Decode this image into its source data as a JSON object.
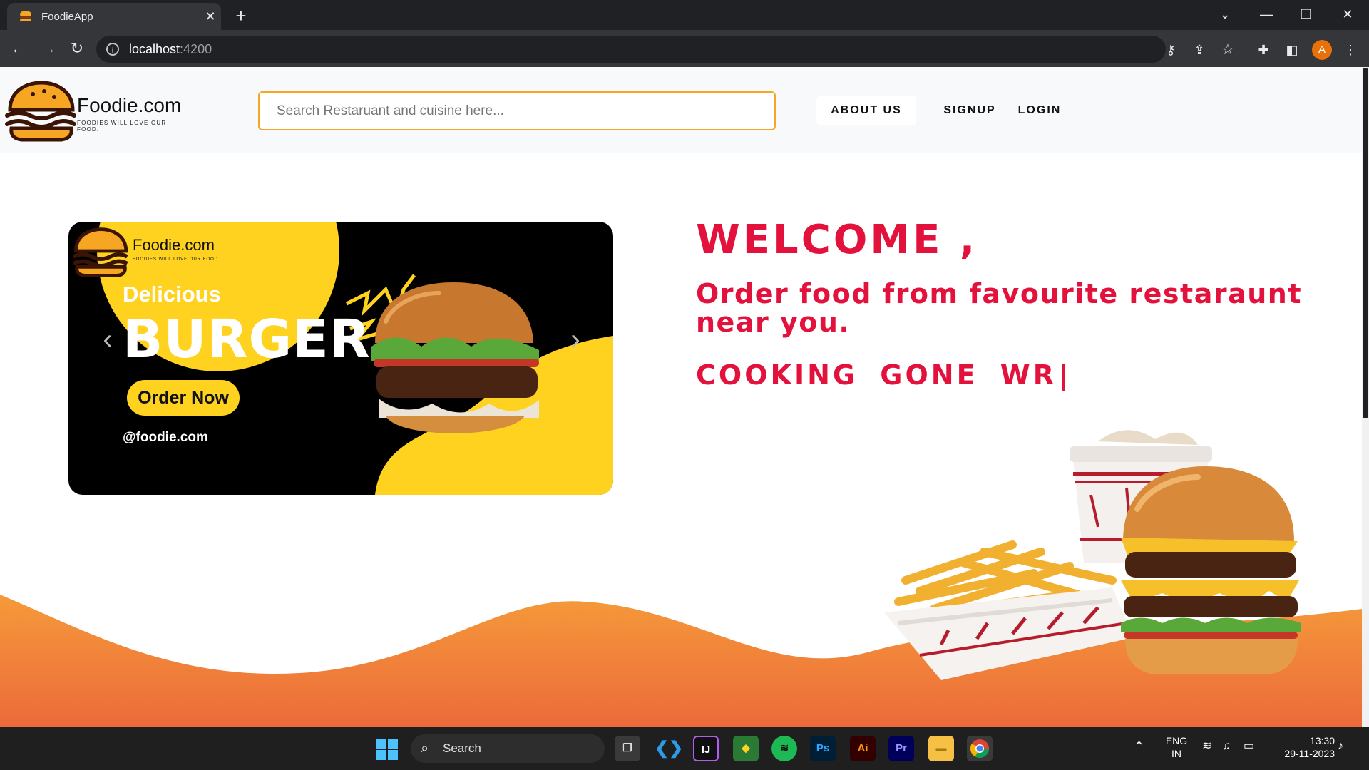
{
  "browser": {
    "tab_title": "FoodieApp",
    "url_host": "localhost",
    "url_port": ":4200",
    "profile_initial": "A"
  },
  "navbar": {
    "brand_name": "Foodie.com",
    "brand_tagline": "FOODIES WILL LOVE OUR FOOD.",
    "search_placeholder": "Search Restaruant and cuisine here...",
    "links": {
      "about": "ABOUT US",
      "signup": "SIGNUP",
      "login": "LOGIN"
    }
  },
  "carousel": {
    "brand_name": "Foodie.com",
    "brand_tagline": "FOODIES WILL LOVE OUR FOOD.",
    "headline_small": "Delicious",
    "headline_big": "BURGER",
    "cta": "Order Now",
    "handle": "@foodie.com"
  },
  "hero": {
    "welcome": "WELCOME ,",
    "subtitle": "Order food from favourite restaraunt near you.",
    "typed_text": "COOKING GONE WR"
  },
  "taskbar": {
    "search_label": "Search",
    "lang_line1": "ENG",
    "lang_line2": "IN",
    "time": "13:30",
    "date": "29-11-2023",
    "apps": [
      "Ps",
      "Ai",
      "Pr"
    ]
  },
  "colors": {
    "accent_red": "#e3123d",
    "brand_yellow": "#ffd21f",
    "wave_orange": "#f0822f",
    "search_border": "#f6a623"
  }
}
